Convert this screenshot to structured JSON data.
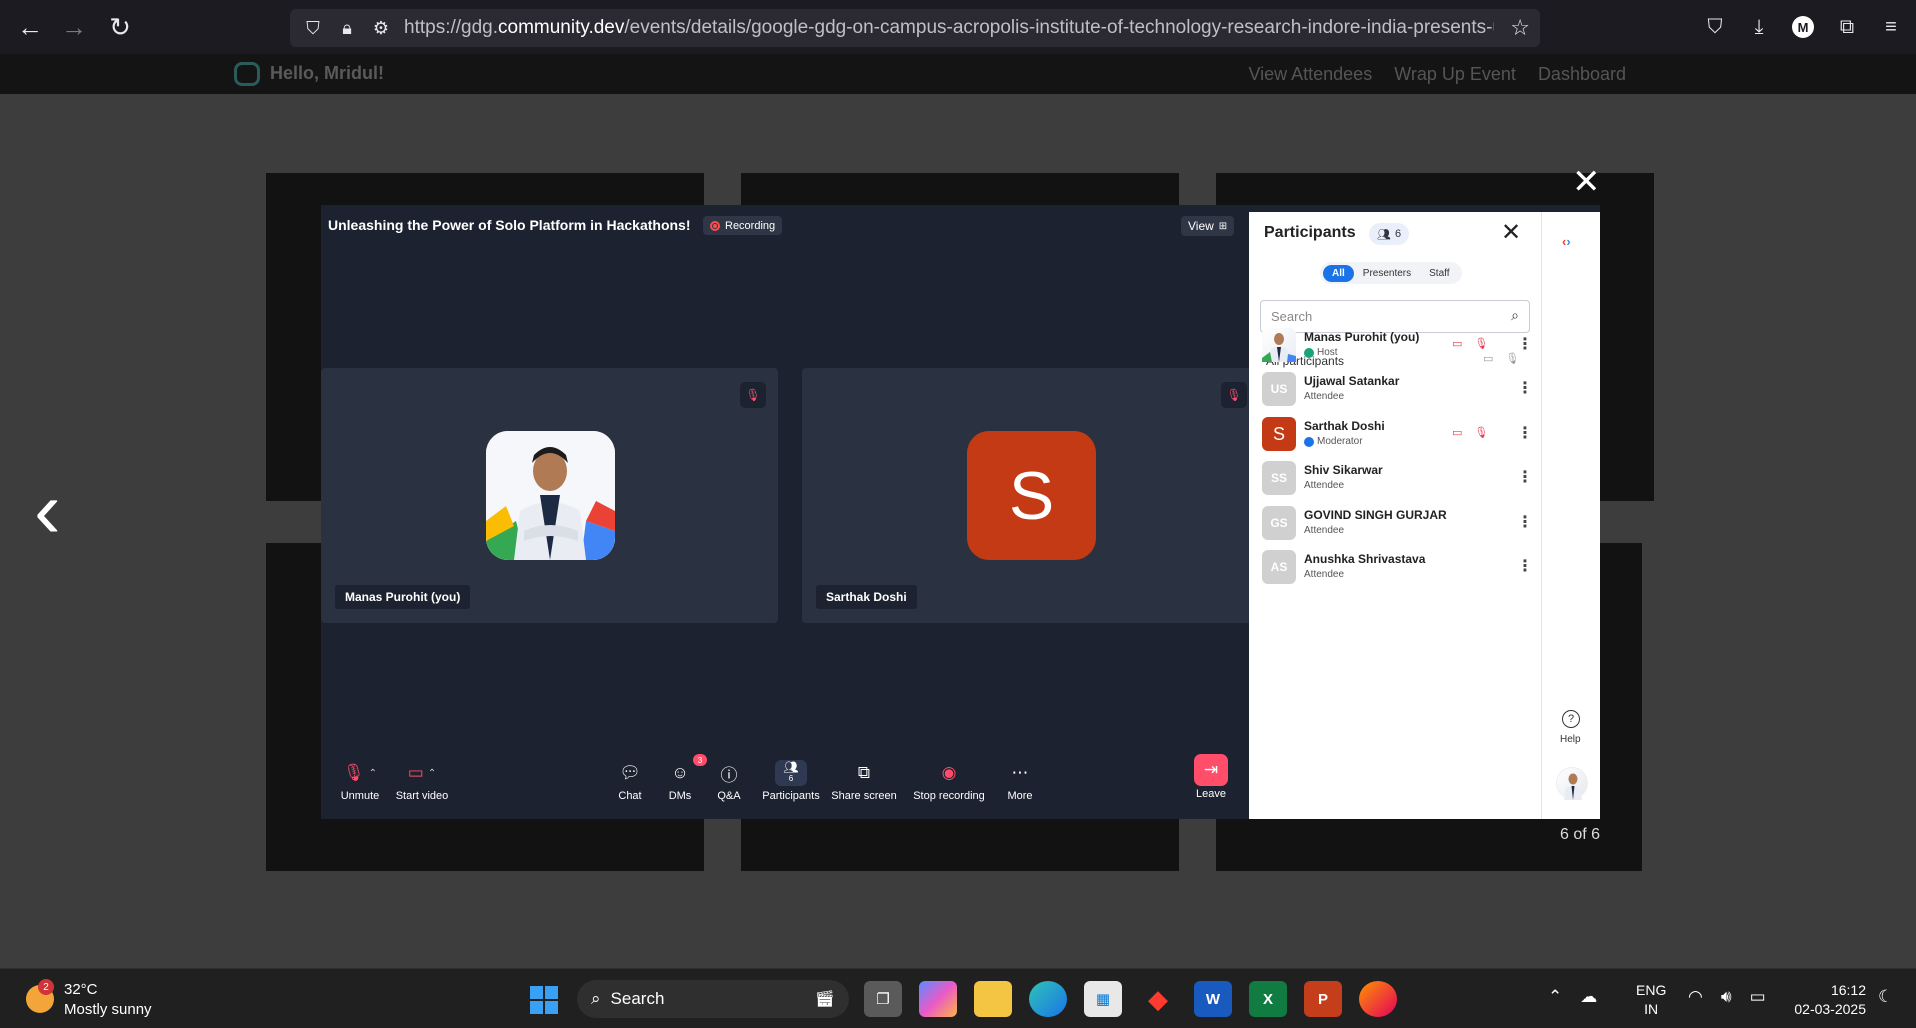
{
  "browser": {
    "url_prefix": "https://gdg.",
    "url_domain": "community.dev",
    "url_path": "/events/details/google-gdg-on-campus-acropolis-institute-of-technology-research-indore-india-presents-unleashing",
    "profile_initial": "M"
  },
  "site": {
    "greeting": "Hello, Mridul!",
    "nav": [
      "View Attendees",
      "Wrap Up Event",
      "Dashboard"
    ]
  },
  "gallery": {
    "counter": "6 of 6"
  },
  "meeting": {
    "title": "Unleashing the Power of Solo Platform in Hackathons!",
    "recording_label": "Recording",
    "view_label": "View",
    "tiles": [
      {
        "name": "Manas Purohit (you)"
      },
      {
        "name": "Sarthak Doshi",
        "initial": "S"
      }
    ],
    "toolbar": {
      "unmute": "Unmute",
      "start_video": "Start video",
      "chat": "Chat",
      "dms": "DMs",
      "dms_badge": "3",
      "qa": "Q&A",
      "participants": "Participants",
      "participants_count": "6",
      "share_screen": "Share screen",
      "stop_recording": "Stop recording",
      "more": "More",
      "leave": "Leave"
    }
  },
  "panel": {
    "title": "Participants",
    "count": "6",
    "tabs": [
      "All",
      "Presenters",
      "Staff"
    ],
    "search_placeholder": "Search",
    "all_participants": "All participants",
    "participants": [
      {
        "name": "Manas Purohit (you)",
        "role": "Host"
      },
      {
        "name": "Ujjawal Satankar",
        "role": "Attendee",
        "initials": "US"
      },
      {
        "name": "Sarthak Doshi",
        "role": "Moderator",
        "initials": "S"
      },
      {
        "name": "Shiv Sikarwar",
        "role": "Attendee",
        "initials": "SS"
      },
      {
        "name": "GOVIND SINGH GURJAR",
        "role": "Attendee",
        "initials": "GS"
      },
      {
        "name": "Anushka Shrivastava",
        "role": "Attendee",
        "initials": "AS"
      }
    ],
    "help": "Help"
  },
  "taskbar": {
    "weather_badge": "2",
    "temperature": "32°C",
    "weather": "Mostly sunny",
    "search": "Search",
    "lang_1": "ENG",
    "lang_2": "IN",
    "time": "16:12",
    "date": "02-03-2025"
  }
}
